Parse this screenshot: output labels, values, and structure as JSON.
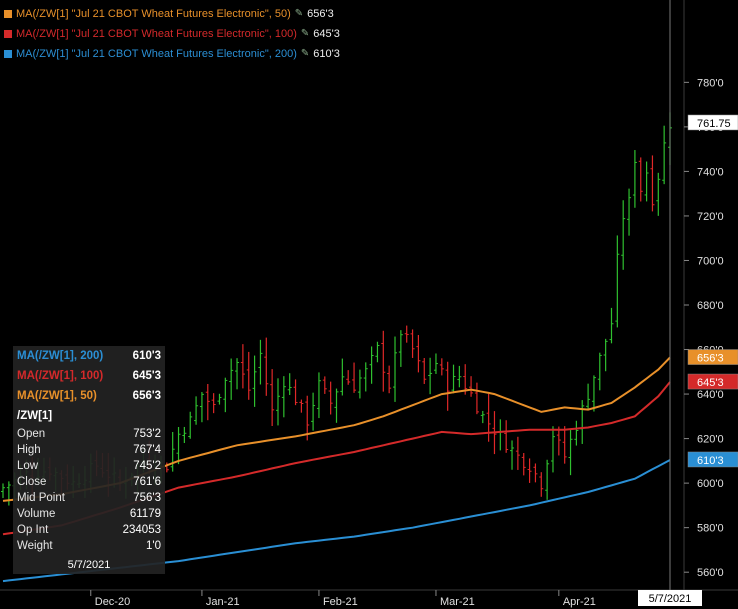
{
  "legend": [
    {
      "label": "MA(/ZW[1] \"Jul 21 CBOT Wheat Futures Electronic\", 50)",
      "value": "656'3",
      "color": "#e8902a"
    },
    {
      "label": "MA(/ZW[1] \"Jul 21 CBOT Wheat Futures Electronic\", 100)",
      "value": "645'3",
      "color": "#d42a2a"
    },
    {
      "label": "MA(/ZW[1] \"Jul 21 CBOT Wheat Futures Electronic\", 200)",
      "value": "610'3",
      "color": "#2a8fd4"
    }
  ],
  "legend_icon": "pencil-icon",
  "tooltip": {
    "ma_rows": [
      {
        "label": "MA(/ZW[1], 200)",
        "value": "610'3",
        "color": "#2a8fd4"
      },
      {
        "label": "MA(/ZW[1], 100)",
        "value": "645'3",
        "color": "#d42a2a"
      },
      {
        "label": "MA(/ZW[1], 50)",
        "value": "656'3",
        "color": "#e8902a"
      }
    ],
    "symbol": "/ZW[1]",
    "fields": [
      {
        "label": "Open",
        "value": "753'2"
      },
      {
        "label": "High",
        "value": "767'4"
      },
      {
        "label": "Low",
        "value": "745'2"
      },
      {
        "label": "Close",
        "value": "761'6"
      },
      {
        "label": "Mid Point",
        "value": "756'3"
      },
      {
        "label": "Volume",
        "value": "61179"
      },
      {
        "label": "Op Int",
        "value": "234053"
      },
      {
        "label": "Weight",
        "value": "1'0"
      }
    ],
    "date": "5/7/2021"
  },
  "chart_data": {
    "type": "candlestick",
    "ylim": [
      552,
      808
    ],
    "y_ticks": [
      "560'0",
      "580'0",
      "600'0",
      "620'0",
      "640'0",
      "660'0",
      "680'0",
      "700'0",
      "720'0",
      "740'0",
      "760'0",
      "780'0"
    ],
    "y_tick_values": [
      560,
      580,
      600,
      620,
      640,
      660,
      680,
      700,
      720,
      740,
      760,
      780
    ],
    "x_ticks": [
      "Dec-20",
      "Jan-21",
      "Feb-21",
      "Mar-21",
      "Apr-21"
    ],
    "x_tick_index": [
      15,
      34,
      54,
      74,
      95
    ],
    "n_bars": 115,
    "price_labels": [
      {
        "text": "761.75",
        "value": 761.75,
        "bg": "#ffffff",
        "fg": "#000000"
      },
      {
        "text": "656'3",
        "value": 656.4,
        "bg": "#e8902a",
        "fg": "#ffffff"
      },
      {
        "text": "645'3",
        "value": 645.4,
        "bg": "#d42a2a",
        "fg": "#ffffff"
      },
      {
        "text": "610'3",
        "value": 610.4,
        "bg": "#2a8fd4",
        "fg": "#ffffff"
      }
    ],
    "cursor_date": "5/7/2021",
    "cursor_index": 114,
    "close_anchors": [
      [
        0,
        598
      ],
      [
        4,
        604
      ],
      [
        8,
        606
      ],
      [
        12,
        600
      ],
      [
        16,
        608
      ],
      [
        20,
        600
      ],
      [
        24,
        610
      ],
      [
        28,
        608
      ],
      [
        30,
        622
      ],
      [
        32,
        628
      ],
      [
        34,
        640
      ],
      [
        36,
        634
      ],
      [
        38,
        648
      ],
      [
        40,
        654
      ],
      [
        42,
        642
      ],
      [
        44,
        658
      ],
      [
        46,
        632
      ],
      [
        48,
        646
      ],
      [
        50,
        638
      ],
      [
        52,
        628
      ],
      [
        54,
        644
      ],
      [
        56,
        636
      ],
      [
        58,
        648
      ],
      [
        60,
        644
      ],
      [
        62,
        650
      ],
      [
        64,
        660
      ],
      [
        66,
        644
      ],
      [
        68,
        668
      ],
      [
        70,
        660
      ],
      [
        72,
        646
      ],
      [
        74,
        654
      ],
      [
        76,
        644
      ],
      [
        78,
        648
      ],
      [
        80,
        640
      ],
      [
        82,
        630
      ],
      [
        84,
        624
      ],
      [
        86,
        618
      ],
      [
        88,
        612
      ],
      [
        90,
        608
      ],
      [
        92,
        600
      ],
      [
        94,
        622
      ],
      [
        96,
        612
      ],
      [
        98,
        626
      ],
      [
        100,
        640
      ],
      [
        102,
        656
      ],
      [
        104,
        672
      ],
      [
        105,
        700
      ],
      [
        106,
        720
      ],
      [
        107,
        726
      ],
      [
        108,
        746
      ],
      [
        109,
        732
      ],
      [
        110,
        740
      ],
      [
        111,
        728
      ],
      [
        112,
        738
      ],
      [
        113,
        752
      ],
      [
        114,
        761.75
      ]
    ],
    "ma_series": [
      {
        "name": "MA 50",
        "color": "#e8902a",
        "anchors": [
          [
            0,
            592
          ],
          [
            10,
            595
          ],
          [
            20,
            600
          ],
          [
            30,
            610
          ],
          [
            40,
            617
          ],
          [
            50,
            621
          ],
          [
            60,
            626
          ],
          [
            65,
            630
          ],
          [
            70,
            635
          ],
          [
            75,
            640
          ],
          [
            80,
            642
          ],
          [
            84,
            640
          ],
          [
            88,
            636
          ],
          [
            92,
            632
          ],
          [
            96,
            634
          ],
          [
            100,
            633
          ],
          [
            104,
            636
          ],
          [
            108,
            643
          ],
          [
            112,
            651
          ],
          [
            114,
            656.4
          ]
        ]
      },
      {
        "name": "MA 100",
        "color": "#d42a2a",
        "anchors": [
          [
            0,
            577
          ],
          [
            10,
            581
          ],
          [
            20,
            589
          ],
          [
            30,
            598
          ],
          [
            40,
            603
          ],
          [
            50,
            609
          ],
          [
            60,
            614
          ],
          [
            70,
            620
          ],
          [
            75,
            623
          ],
          [
            80,
            622
          ],
          [
            90,
            624
          ],
          [
            96,
            624
          ],
          [
            100,
            625
          ],
          [
            104,
            627
          ],
          [
            108,
            630
          ],
          [
            112,
            639
          ],
          [
            114,
            645.4
          ]
        ]
      },
      {
        "name": "MA 200",
        "color": "#2a8fd4",
        "anchors": [
          [
            0,
            556
          ],
          [
            10,
            559
          ],
          [
            20,
            562
          ],
          [
            30,
            565
          ],
          [
            40,
            569
          ],
          [
            50,
            573
          ],
          [
            60,
            576
          ],
          [
            70,
            580
          ],
          [
            80,
            585
          ],
          [
            90,
            590
          ],
          [
            100,
            596
          ],
          [
            108,
            602
          ],
          [
            114,
            610.4
          ]
        ]
      }
    ]
  }
}
